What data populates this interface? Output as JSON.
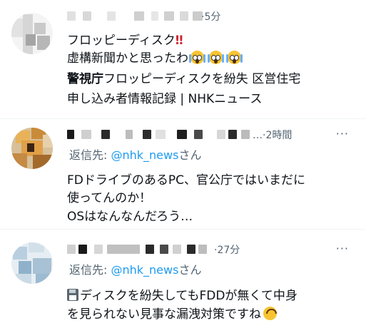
{
  "tweets": [
    {
      "time": "5分",
      "lines": [
        "フロッピーディスク",
        "虚構新聞かと思ったわ"
      ],
      "bang": "‼",
      "headline_bold": "警視庁",
      "headline_rest": "フロッピーディスクを紛失 区営住宅",
      "headline_line2": "申し込み者情報記録 | NHKニュース",
      "emoji": [
        "screaming-face",
        "screaming-face",
        "screaming-face"
      ]
    },
    {
      "time": "2時間",
      "ellipsis": "…",
      "reply_prefix": "返信先: ",
      "reply_handle": "@nhk_news",
      "reply_suffix": "さん",
      "lines": [
        "FDドライブのあるPC、官公庁ではいまだに",
        "使ってんのか！",
        "OSはなんなんだろう…"
      ]
    },
    {
      "time": "27分",
      "reply_prefix": "返信先: ",
      "reply_handle": "@nhk_news",
      "reply_suffix": "さん",
      "line1": "ディスクを紛失してもFDDが無くて中身",
      "line2": "を見られない見事な漏洩対策ですね",
      "emoji": [
        "floppy-disk",
        "upside-down-face"
      ]
    }
  ],
  "separator": "·",
  "more_label": "···",
  "colors": {
    "link": "#1d9bf0",
    "muted": "#536471",
    "text": "#0f1419"
  }
}
